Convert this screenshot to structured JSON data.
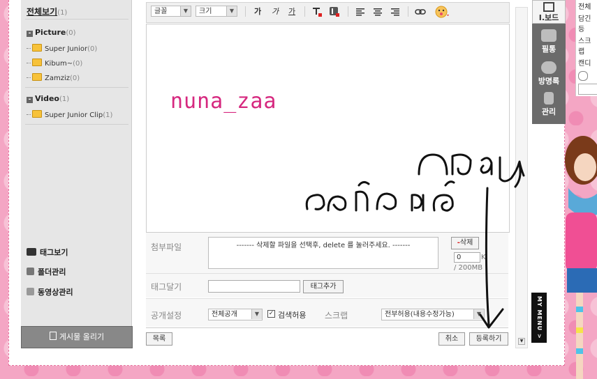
{
  "sidebar": {
    "all_view": "전체보기",
    "all_count": "(1)",
    "groups": [
      {
        "name": "Picture",
        "count": "(0)",
        "items": [
          {
            "name": "Super Junior",
            "count": "(0)"
          },
          {
            "name": "Kibum~",
            "count": "(0)"
          },
          {
            "name": "Zamziz",
            "count": "(0)"
          }
        ]
      },
      {
        "name": "Video",
        "count": "(1)",
        "items": [
          {
            "name": "Super Junior Clip",
            "count": "(1)"
          }
        ]
      }
    ],
    "tools": {
      "tag_view": "태그보기",
      "folder_manage": "폴더관리",
      "video_manage": "동영상관리"
    },
    "post_button": "게시물 올리기"
  },
  "toolbar": {
    "font_select": "글꼴",
    "size_select": "크기",
    "btn_bold": "가",
    "btn_italic": "가",
    "btn_underline": "가"
  },
  "editor": {
    "content": "nuna_zaa"
  },
  "form": {
    "attach_label": "첨부파일",
    "attach_hint": "------- 삭제할 파일을 선택후, delete 를 눌러주세요. -------",
    "delete_button": "삭제",
    "size_value": "0",
    "size_unit": "K",
    "size_total": "/ 200MB",
    "tag_label": "태그달기",
    "tag_add_button": "태그추가",
    "visibility_label": "공개설정",
    "visibility_value": "전체공개",
    "search_allow": "검색허용",
    "scrap_label": "스크랩",
    "scrap_value": "전부허용(내용수정가능)"
  },
  "actions": {
    "list": "목록",
    "cancel": "취소",
    "submit": "등록하기"
  },
  "right_nav": {
    "ibod": "I.보드",
    "photo": "필통",
    "guestbook": "방명록",
    "manage": "관리",
    "my_menu": "MY MENU >"
  },
  "right_panel": {
    "lines": [
      "전체",
      "담긴등",
      "스크랩",
      "캔디"
    ]
  },
  "colors": {
    "editor_text": "#d6287f",
    "accent_pink": "#f4a6c4",
    "nav_gray": "#6b6b6b"
  }
}
